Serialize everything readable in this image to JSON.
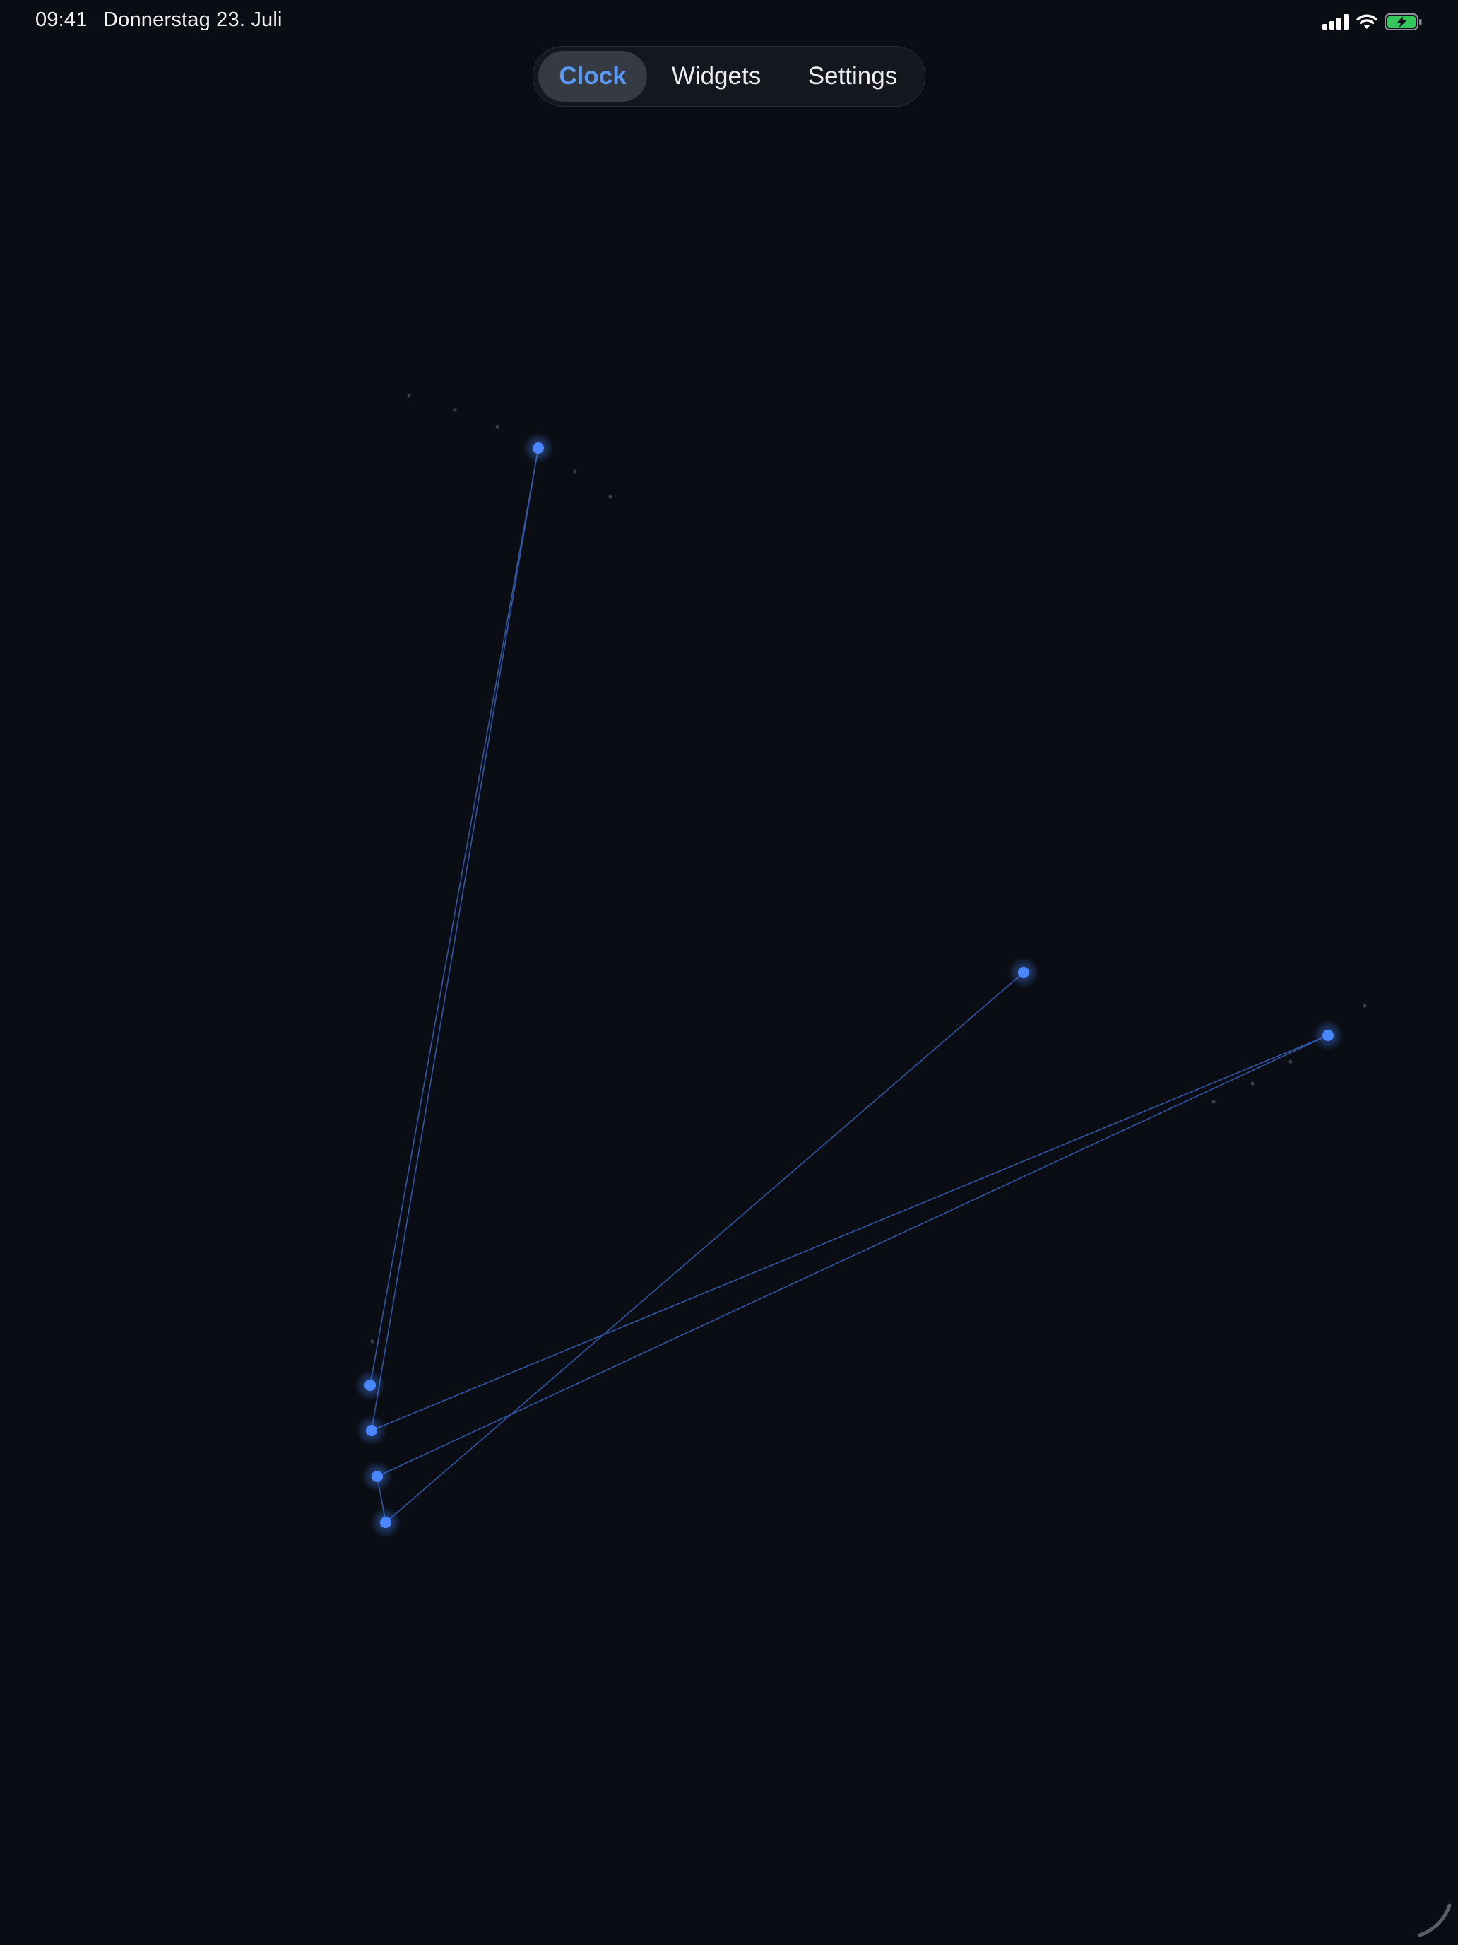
{
  "status_bar": {
    "time": "09:41",
    "date": "Donnerstag 23. Juli",
    "icons": [
      "cellular-signal-icon",
      "wifi-icon",
      "battery-charging-icon"
    ]
  },
  "tabs": [
    {
      "label": "Clock",
      "active": true
    },
    {
      "label": "Widgets",
      "active": false
    },
    {
      "label": "Settings",
      "active": false
    }
  ],
  "colors": {
    "background": "#0a0d13",
    "accent": "#5b98f4",
    "node": "#4a86ff",
    "line": "#3a63c0",
    "battery": "#34c759"
  }
}
